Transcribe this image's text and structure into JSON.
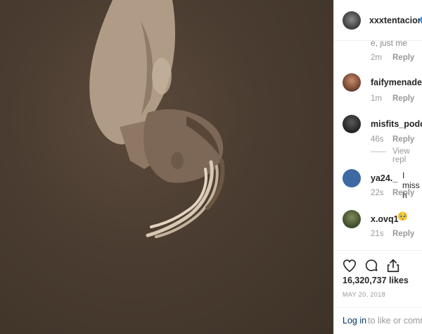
{
  "post": {
    "author": "xxxtentacion",
    "likes": "16,320,737 likes",
    "date": "MAY 20, 2018"
  },
  "comments": [
    {
      "username": "",
      "text_fragment": "e, just me",
      "time": "2m",
      "reply": "Reply"
    },
    {
      "username": "faifymenadeic",
      "text": "",
      "time": "1m",
      "reply": "Reply"
    },
    {
      "username": "misfits_podca",
      "text": "",
      "time": "46s",
      "reply": "Reply",
      "view_replies": "View repl"
    },
    {
      "username": "ya24._",
      "text": "I miss h",
      "time": "22s",
      "reply": "Reply"
    },
    {
      "username": "x.ovq1",
      "text": "🥺",
      "time": "21s",
      "reply": "Reply"
    }
  ],
  "actions": {
    "like_icon": "heart-icon",
    "comment_icon": "speech-bubble-icon",
    "share_icon": "share-icon"
  },
  "login": {
    "link": "Log in",
    "rest": "to like or comme"
  },
  "colors": {
    "verified_badge": "#3897f0",
    "avatar_blue": "#3d6aa3",
    "photo_bg": "#4a3c30"
  }
}
